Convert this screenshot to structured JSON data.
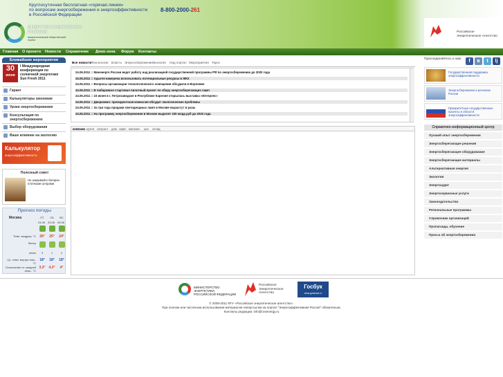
{
  "header": {
    "hotline_line1": "Круглосуточная бесплатная «горячая линия»",
    "hotline_line2": "по вопросам энергосбережения и энергоэффективности",
    "hotline_line3": "в Российской Федерации",
    "phone_main": "8-800-2000-",
    "phone_tail": "261",
    "logo_title_1": "ЭНЕРГОЭФФЕКТИВНАЯ",
    "logo_title_2": "РОССИЯ",
    "logo_sub": "межрегиональный общественный портал",
    "rea_name": "Российское Энергетическое Агентство"
  },
  "nav": [
    "Главная",
    "О проекте",
    "Новости",
    "Справочник",
    "Демо-зона",
    "Форум",
    "Контакты"
  ],
  "left": {
    "events_title": "Ближайшие мероприятия",
    "event_day": "30",
    "event_month": "июня",
    "event_text": "I Международная конференция по солнечной энергетике Sun Fresh 2011",
    "menu": [
      "Гарант",
      "Калькуляторы экономии",
      "Уроки энергосбережения",
      "Консультация по энергосбережению",
      "Выбор оборудования",
      "Ваше влияние на экологию"
    ],
    "calc_title": "Калькулятор",
    "calc_sub": "энергоэффективность",
    "advice_title": "Полезный совет",
    "advice_text": "Не закрывайте батареи плотными шторами",
    "weather": {
      "title": "Прогноз погоды",
      "city": "Москва",
      "days": [
        "ПТ",
        "СБ",
        "ВС"
      ],
      "dates": [
        "24.06",
        "25.06",
        "26.06"
      ],
      "air_label": "Темп. воздуха, °С",
      "air": [
        "26°",
        "25°",
        "24°"
      ],
      "wind_label": "Ветер",
      "speed_label": "м/сек",
      "speed": [
        "3",
        "1",
        "2"
      ],
      "building_label": "Ср. темп. внутри пом., °С",
      "building": [
        "18°",
        "18°",
        "18°"
      ],
      "deviation_label": "Отклонение от средней темп., °С",
      "deviation": [
        "3.3°",
        "4.3°",
        "4°"
      ]
    }
  },
  "middle": {
    "tabs": [
      "Все новости",
      "Технологии",
      "Власть",
      "Энергосбережение",
      "Экология",
      "Над портал",
      "Мероприятия",
      "Торги"
    ],
    "news": [
      "24.06.2011 :: Минэнерго России ведет работу над реализацией государственной программы РФ по энергосбережению до 2020 года",
      "24.06.2011 :: Адыгея намерена использовать потенциальные ресурсы в ЖКХ",
      "24.06.2011 :: Вопросы организации технологического освещения обсудили в Воронеже",
      "24.06.2011 :: В Хабаровске стартовал пилотный проект по сбору энергосберегающих ламп",
      "24.06.2011 :: 23 июня в г. Петрозаводске в Республике Карелия открылась выставка «Интерлес»",
      "24.06.2011 :: Дворкович: президентская комиссия обсудит экологические проблемы",
      "24.06.2011 :: За три года продажи светодиодных ламп в Москве вырастут в разы",
      "24.06.2011 :: На программу энергосбережения в Москве выделят 230 млрд руб до 2015 года"
    ],
    "tabs2": [
      "компани",
      "кухня",
      "санузел",
      "дом",
      "офис",
      "магазин",
      "цех",
      "склад"
    ]
  },
  "right": {
    "join_label": "Присоединяйтесь к нам",
    "banners": [
      "Государственная поддержка энергоэффективности",
      "Энергосбережение в регионах России",
      "Приоритетные государственные проекты в области энергоэффективности"
    ],
    "ref_title": "Справочно-информационный центр",
    "links": [
      "Лучший опыт энергосбережения",
      "Энергосберегающие решения",
      "Энергосберегающее оборудование",
      "Энергосберегающие материалы",
      "Альтернативная энергия",
      "Экология",
      "Энергоаудит",
      "Энергосервисные услуги",
      "Законодательство",
      "Региональные программы",
      "Справочник организаций",
      "Пропаганда, обучение",
      "Пресса об энергосбережении"
    ]
  },
  "footer": {
    "ministry": "МИНИСТЕРСТВО ЭНЕРГЕТИКИ РОССИЙСКОЙ ФЕДЕРАЦИИ",
    "rea": "Российское Энергетическое Агентство",
    "gosbuk": "Госбук",
    "gosbuk_sub": "www.gosbook.ru",
    "copyright": "© 2009-2011 ФГУ «Российское энергетическое агентство».",
    "notice": "При полном или частичном использовании материалов гиперссылка на портал \"Энергоэффективная Россия\" обязательна.",
    "contacts": "Контакты редакции: info@rosenergy.ru"
  },
  "colors": {
    "nav_green": "#2f6a18",
    "brand_blue": "#1c3b8c",
    "event_red": "#b0201e"
  }
}
